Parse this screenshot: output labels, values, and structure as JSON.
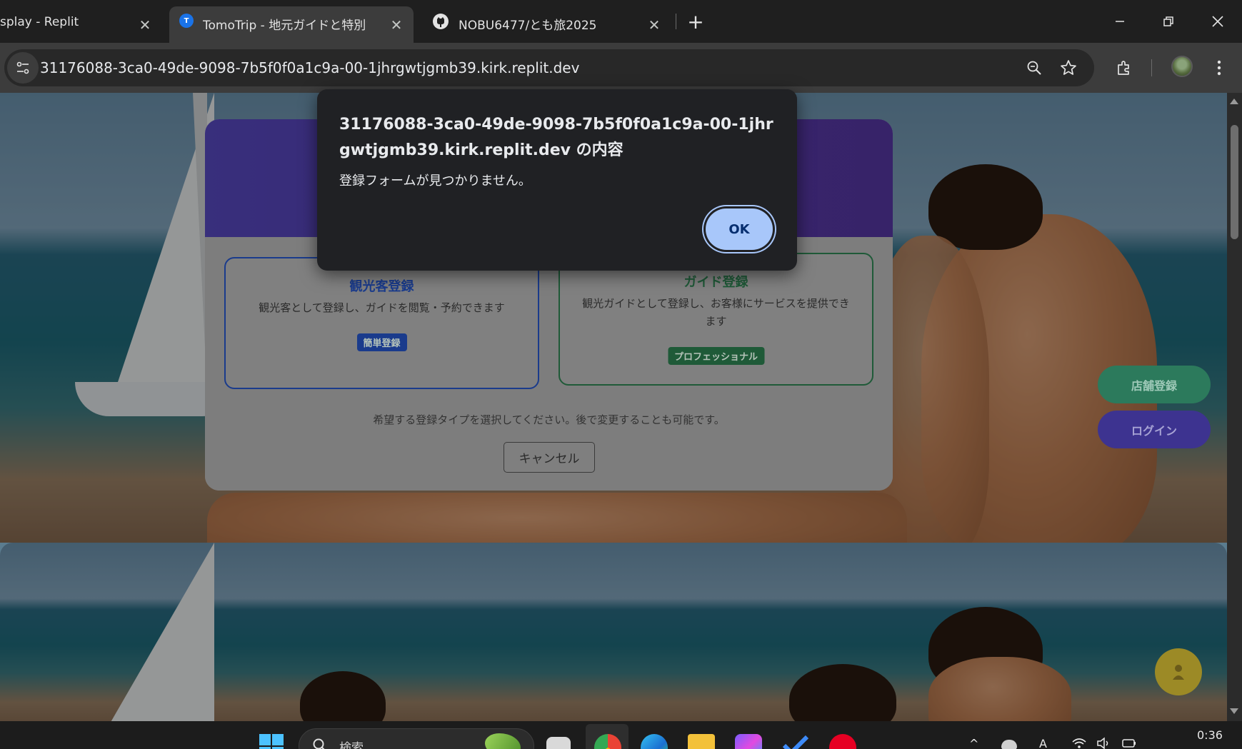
{
  "browser": {
    "tabs": [
      {
        "label": "splay - Replit",
        "active": false
      },
      {
        "label": "TomoTrip - 地元ガイドと特別な旅",
        "active": true
      },
      {
        "label": "NOBU6477/とも旅2025",
        "active": false
      }
    ],
    "address_bar": {
      "url": "31176088-3ca0-49de-9098-7b5f0f0a1c9a-00-1jhrgwtjgmb39.kirk.replit.dev"
    }
  },
  "dialog": {
    "title": "31176088-3ca0-49de-9098-7b5f0f0a1c9a-00-1jhrgwtjgmb39.kirk.replit.dev の内容",
    "message": "登録フォームが見つかりません。",
    "ok_label": "OK"
  },
  "registration": {
    "tourist": {
      "title": "観光客登録",
      "description": "観光客として登録し、ガイドを閲覧・予約できます",
      "badge": "簡単登録"
    },
    "guide": {
      "title": "ガイド登録",
      "description": "観光ガイドとして登録し、お客様にサービスを提供できます",
      "badge": "プロフェッショナル"
    },
    "hint": "希望する登録タイプを選択してください。後で変更することも可能です。",
    "cancel_label": "キャンセル"
  },
  "floating": {
    "store_register": "店舗登録",
    "login": "ログイン"
  },
  "taskbar": {
    "search_placeholder": "検索",
    "clock": "0:36"
  },
  "colors": {
    "dialog_bg": "#202124",
    "ok_button": "#a8c7fa",
    "tourist_accent": "#1a3b8c",
    "guide_accent": "#1f5a38",
    "header_gradient": "#4b3fa6"
  }
}
